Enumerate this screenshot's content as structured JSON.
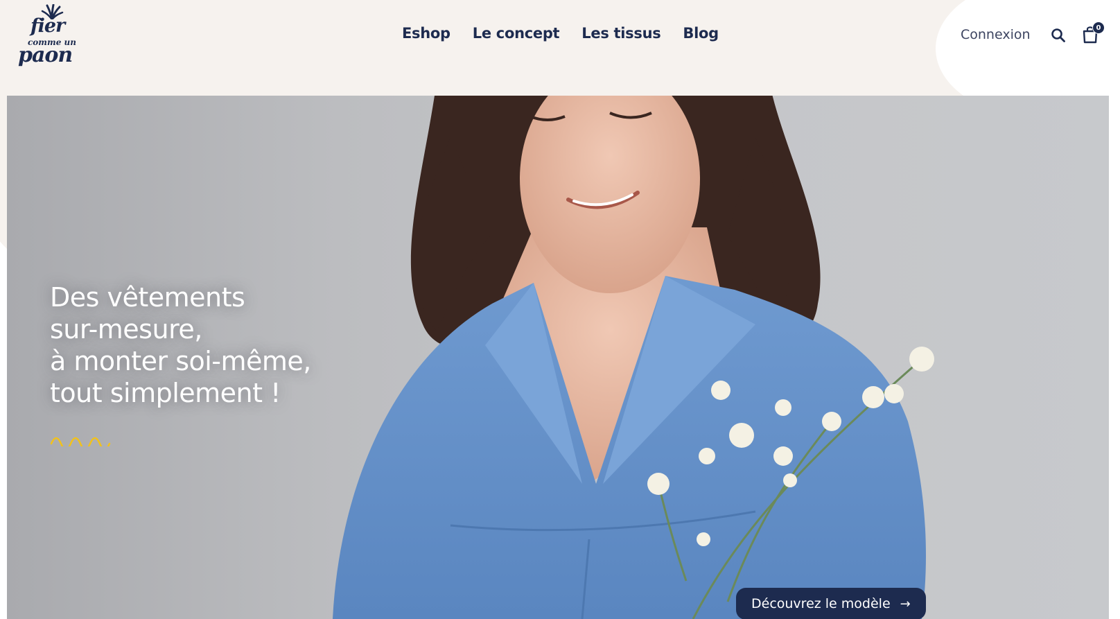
{
  "brand": {
    "logo_line1": "fier",
    "logo_line2": "comme un",
    "logo_line3": "paon",
    "navy": "#1d2b4f",
    "cream": "#f6f2ee",
    "accent_yellow": "#f2c21b"
  },
  "nav": {
    "items": [
      {
        "label": "Eshop"
      },
      {
        "label": "Le concept"
      },
      {
        "label": "Les tissus"
      },
      {
        "label": "Blog"
      }
    ]
  },
  "account": {
    "login_label": "Connexion",
    "search_icon": "search-icon",
    "cart_icon": "shopping-bag-icon",
    "cart_count": "0"
  },
  "hero": {
    "lines": [
      "Des vêtements",
      "sur-mesure,",
      "à monter soi-même,",
      "tout simplement !"
    ],
    "cta_label": "Découvrez le modèle",
    "cta_icon": "arrow-right-icon"
  }
}
